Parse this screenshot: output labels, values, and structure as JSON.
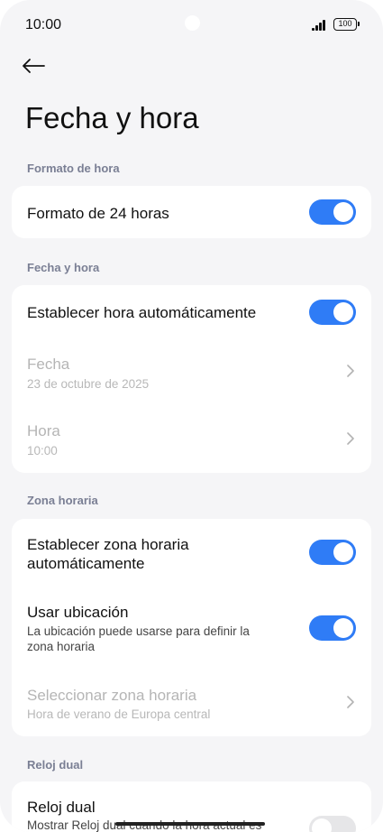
{
  "status": {
    "time": "10:00",
    "battery": "100"
  },
  "header": {
    "title": "Fecha y hora"
  },
  "sections": {
    "time_format": {
      "label": "Formato de hora",
      "format24": {
        "title": "Formato de 24 horas",
        "enabled": true
      }
    },
    "date_time": {
      "label": "Fecha y hora",
      "auto_time": {
        "title": "Establecer hora automáticamente",
        "enabled": true
      },
      "date": {
        "title": "Fecha",
        "value": "23 de octubre de 2025"
      },
      "time": {
        "title": "Hora",
        "value": "10:00"
      }
    },
    "timezone": {
      "label": "Zona horaria",
      "auto_zone": {
        "title_line1": "Establecer zona horaria",
        "title_line2": "automáticamente",
        "enabled": true
      },
      "use_location": {
        "title": "Usar ubicación",
        "sub_line1": "La ubicación puede usarse para definir la",
        "sub_line2": "zona horaria",
        "enabled": true
      },
      "select_zone": {
        "title": "Seleccionar zona horaria",
        "value": "Hora de verano de Europa central"
      }
    },
    "dual_clock": {
      "label": "Reloj dual",
      "dual": {
        "title": "Reloj dual",
        "sub": "Mostrar Reloj dual cuando la hora actual es",
        "enabled": false
      }
    }
  },
  "colors": {
    "accent": "#2f7cf6",
    "background": "#f5f5f7",
    "section_label": "#7a7f94"
  }
}
